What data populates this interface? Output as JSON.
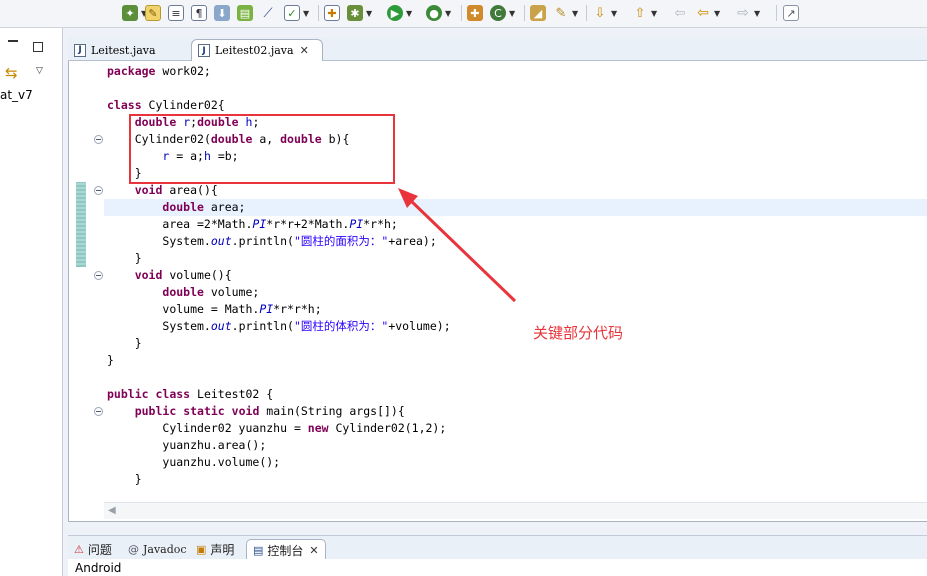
{
  "toolbar": {
    "icons": [
      "new-project-icon",
      "highlight-icon",
      "toggle-block-icon",
      "show-whitespace-icon",
      "save-download-icon",
      "android-sdk-icon",
      "pin-icon",
      "checkbox-icon",
      "new-class-icon",
      "debug-icon",
      "run-icon",
      "run-external-icon",
      "new-package-icon",
      "refresh-icon",
      "open-type-icon",
      "open-task-icon",
      "next-annotation-icon",
      "prev-annotation-icon",
      "last-edit-icon",
      "back-icon",
      "forward-icon",
      "open-perspective-icon"
    ]
  },
  "left_panel": {
    "project_fragment": "at_v7"
  },
  "editor": {
    "tabs": [
      {
        "label": "Leitest.java",
        "active": false
      },
      {
        "label": "Leitest02.java",
        "active": true
      }
    ],
    "code_lines": {
      "l1_a": "package",
      "l1_b": " work02;",
      "l3_a": "class",
      "l3_b": " Cylinder02{",
      "l4_a": "double",
      "l4_r": "r",
      "l4_b": ";",
      "l4_c": "double",
      "l4_h": "h",
      "l4_d": ";",
      "l5_a": "Cylinder02(",
      "l5_b": "double",
      "l5_c": " a, ",
      "l5_d": "double",
      "l5_e": " b){",
      "l6_r": "r",
      "l6_a": " = a;",
      "l6_h": "h",
      "l6_b": " =b;",
      "l7": "}",
      "l8_a": "void",
      "l8_b": " area(){",
      "l9_a": "double",
      "l9_b": " area;",
      "l10_a": "area =2*Math.",
      "l10_pi1": "PI",
      "l10_b": "*r*r+2*Math.",
      "l10_pi2": "PI",
      "l10_c": "*r*h;",
      "l11_a": "System.",
      "l11_out": "out",
      "l11_b": ".println(",
      "l11_str": "\"圆柱的面积为：\"",
      "l11_c": "+area);",
      "l12": "}",
      "l13_a": "void",
      "l13_b": " volume(){",
      "l14_a": "double",
      "l14_b": " volume;",
      "l15_a": "volume = Math.",
      "l15_pi": "PI",
      "l15_b": "*r*r*h;",
      "l16_a": "System.",
      "l16_out": "out",
      "l16_b": ".println(",
      "l16_str": "\"圆柱的体积为：\"",
      "l16_c": "+volume);",
      "l17": "}",
      "l18": "}",
      "l20_a": "public",
      "l20_b": "class",
      "l20_c": " Leitest02 {",
      "l21_a": "public",
      "l21_b": "static",
      "l21_c": "void",
      "l21_d": " main(String args[]){",
      "l22_a": "Cylinder02 yuanzhu = ",
      "l22_b": "new",
      "l22_c": " Cylinder02(1,2);",
      "l23": "yuanzhu.area();",
      "l24": "yuanzhu.volume();",
      "l25": "}"
    }
  },
  "annotation": {
    "label": "关键部分代码",
    "color": "#e8343a"
  },
  "bottom_panel": {
    "tabs": [
      {
        "label": "问题",
        "active": false
      },
      {
        "label": "Javadoc",
        "active": false
      },
      {
        "label": "声明",
        "active": false
      },
      {
        "label": "控制台",
        "active": true
      }
    ],
    "console_text": "Android"
  }
}
